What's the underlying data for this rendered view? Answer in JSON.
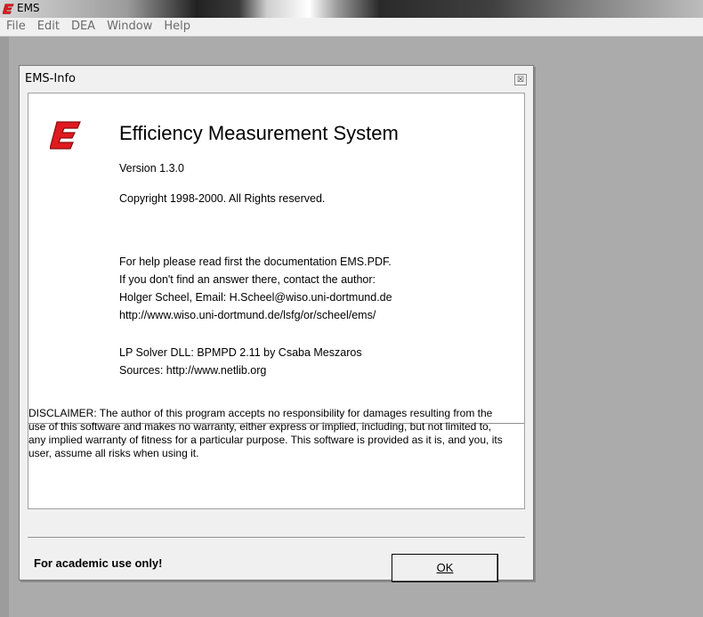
{
  "app": {
    "title": "EMS"
  },
  "menu": {
    "items": [
      "File",
      "Edit",
      "DEA",
      "Window",
      "Help"
    ]
  },
  "dialog": {
    "title": "EMS-Info",
    "close_glyph": "☒",
    "heading": "Efficiency Measurement System",
    "version": "Version 1.3.0",
    "copyright": "Copyright 1998-2000. All Rights reserved.",
    "help_lines": [
      "For help please read first the documentation EMS.PDF.",
      "If you don't find an answer there, contact the author:",
      "Holger Scheel, Email: H.Scheel@wiso.uni-dortmund.de",
      "http://www.wiso.uni-dortmund.de/lsfg/or/scheel/ems/"
    ],
    "solver_lines": [
      "LP Solver DLL: BPMPD 2.11 by Csaba Meszaros",
      "Sources: http://www.netlib.org"
    ],
    "disclaimer": "DISCLAIMER: The author of this program accepts no responsibility for damages resulting from the use of this software and makes no warranty, either express or implied, including, but not limited to, any implied warranty of fitness for a particular purpose. This software is provided as it is, and you, its user, assume all risks when using it.",
    "academic_note": "For academic use only!",
    "ok_label": "OK"
  },
  "colors": {
    "logo_red": "#e0191f",
    "logo_dark": "#8a0d0d"
  },
  "icons": {
    "app_logo": "ems-logo-icon",
    "close": "close-icon"
  }
}
